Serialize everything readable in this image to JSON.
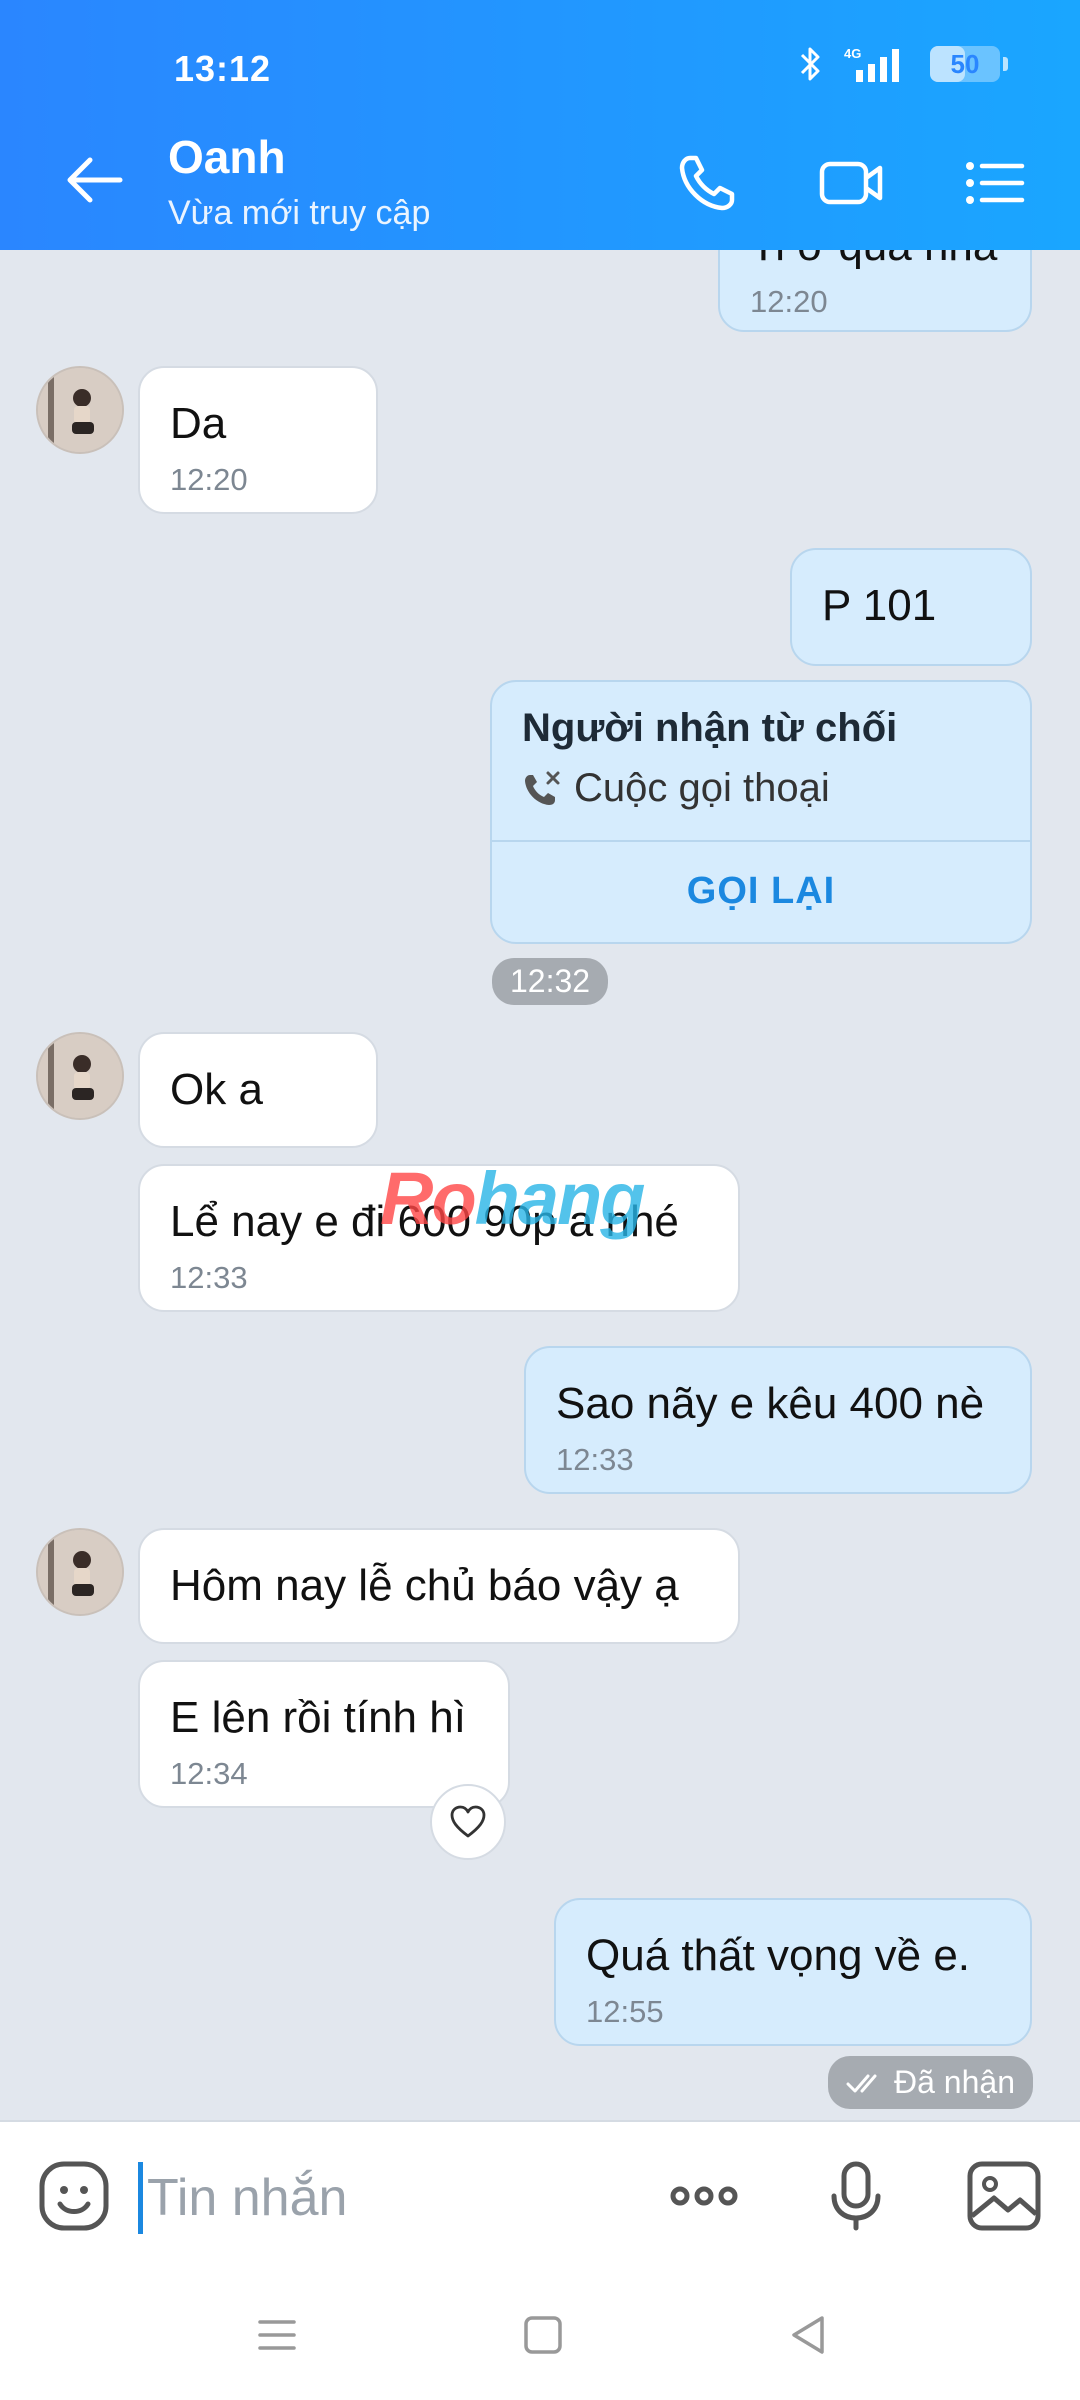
{
  "status_bar": {
    "time": "13:12",
    "network": "4G",
    "battery": "50",
    "battery_level": 0.5
  },
  "header": {
    "contact_name": "Oanh",
    "contact_status": "Vừa mới truy cập"
  },
  "messages": [
    {
      "dir": "out",
      "text": "Ti ở quá nha",
      "time": "12:20"
    },
    {
      "dir": "in",
      "text": "Da",
      "time": "12:20"
    },
    {
      "dir": "out",
      "text": "P 101"
    },
    {
      "dir": "out",
      "type": "call",
      "title": "Người nhận từ chối",
      "subtitle": "Cuộc gọi thoại",
      "action": "GỌI LẠI"
    },
    {
      "dir": "in",
      "text": "Ok a"
    },
    {
      "dir": "in",
      "text": "Lể nay e đi 600 90p a nhé",
      "time": "12:33"
    },
    {
      "dir": "out",
      "text": "Sao nãy e kêu 400 nè",
      "time": "12:33"
    },
    {
      "dir": "in",
      "text": "Hôm nay lễ chủ báo vậy ạ"
    },
    {
      "dir": "in",
      "text": "E lên rồi tính hì",
      "time": "12:34"
    },
    {
      "dir": "out",
      "text": "Quá thất vọng về e.",
      "time": "12:55"
    }
  ],
  "time_separator": "12:32",
  "delivery_status": "Đã nhận",
  "watermark": {
    "part1": "Ro",
    "part2": "hang"
  },
  "input": {
    "placeholder": "Tin nhắn"
  },
  "colors": {
    "header_start": "#2a86ff",
    "header_end": "#1aa6ff",
    "outgoing_bubble": "#d6ecfd",
    "incoming_bubble": "#ffffff",
    "accent": "#1b88e0"
  },
  "icons": [
    "back-arrow-icon",
    "phone-icon",
    "video-call-icon",
    "menu-list-icon",
    "emoji-icon",
    "more-icon",
    "microphone-icon",
    "image-icon",
    "heart-icon",
    "double-check-icon",
    "declined-call-icon",
    "bluetooth-icon",
    "signal-icon"
  ]
}
